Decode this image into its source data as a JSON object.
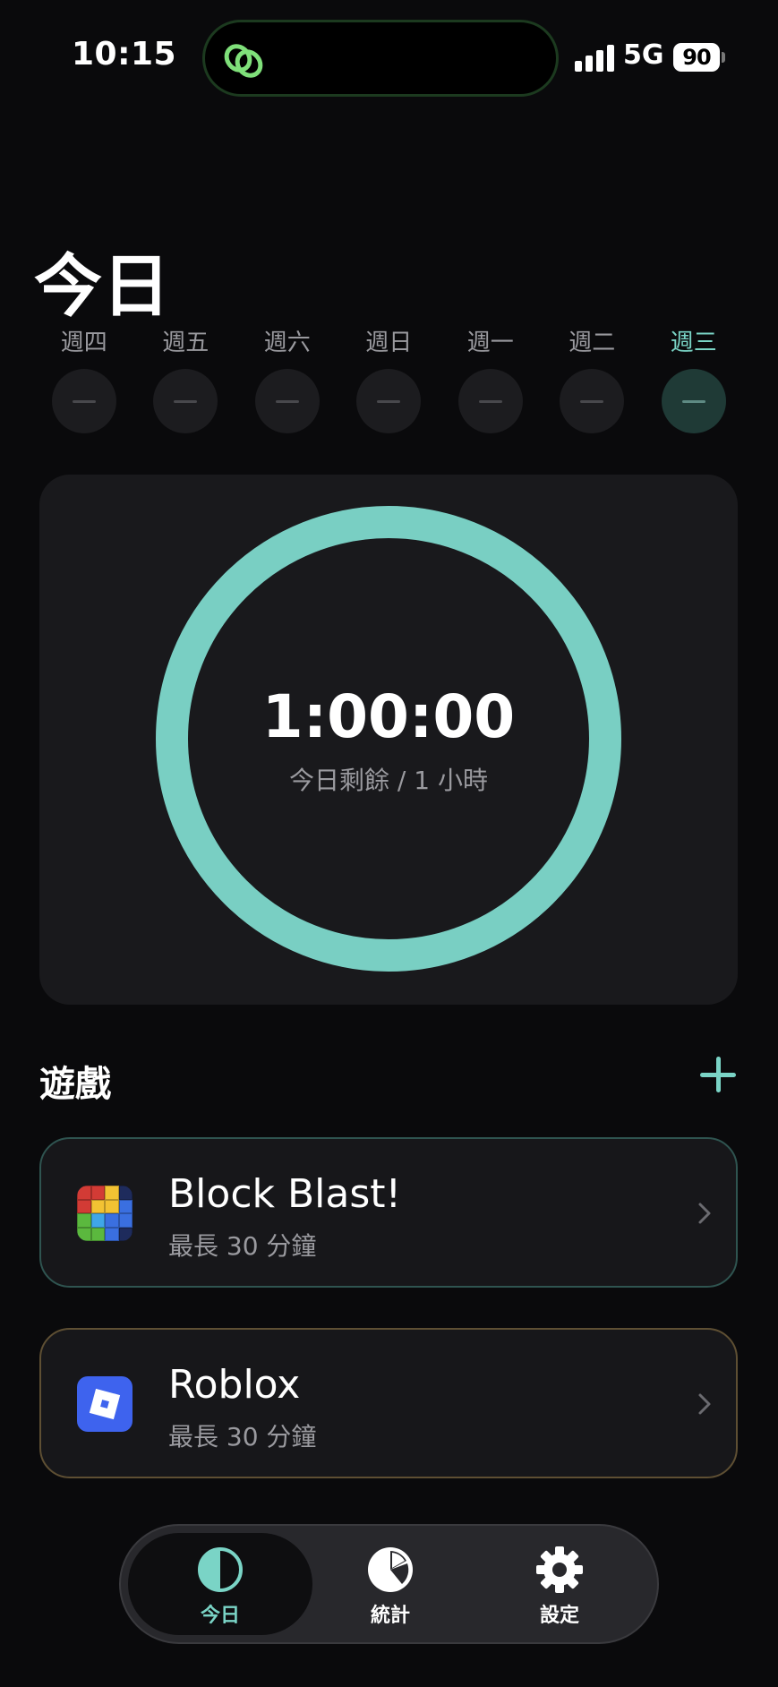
{
  "status_bar": {
    "time": "10:15",
    "network": "5G",
    "battery": "90"
  },
  "page": {
    "title": "今日"
  },
  "week": {
    "days": [
      {
        "label": "週四",
        "value": "—"
      },
      {
        "label": "週五",
        "value": "—"
      },
      {
        "label": "週六",
        "value": "—"
      },
      {
        "label": "週日",
        "value": "—"
      },
      {
        "label": "週一",
        "value": "—"
      },
      {
        "label": "週二",
        "value": "—"
      },
      {
        "label": "週三",
        "value": "—"
      }
    ],
    "active_index": 6
  },
  "timer": {
    "value": "1:00:00",
    "subtitle": "今日剩餘 / 1 小時",
    "remaining_fraction": 1.0,
    "ring_color": "#79cfc3"
  },
  "games": {
    "title": "遊戲",
    "items": [
      {
        "name": "Block Blast!",
        "limit": "最長 30 分鐘",
        "icon": "block-blast-icon"
      },
      {
        "name": "Roblox",
        "limit": "最長 30 分鐘",
        "icon": "roblox-icon"
      }
    ]
  },
  "tabbar": {
    "tabs": [
      {
        "label": "今日",
        "icon": "half-circle-icon",
        "active": true
      },
      {
        "label": "統計",
        "icon": "pie-chart-icon",
        "active": false
      },
      {
        "label": "設定",
        "icon": "gear-icon",
        "active": false
      }
    ]
  },
  "colors": {
    "accent": "#7ad4c6",
    "background": "#0a0a0c",
    "card": "#19191c"
  }
}
